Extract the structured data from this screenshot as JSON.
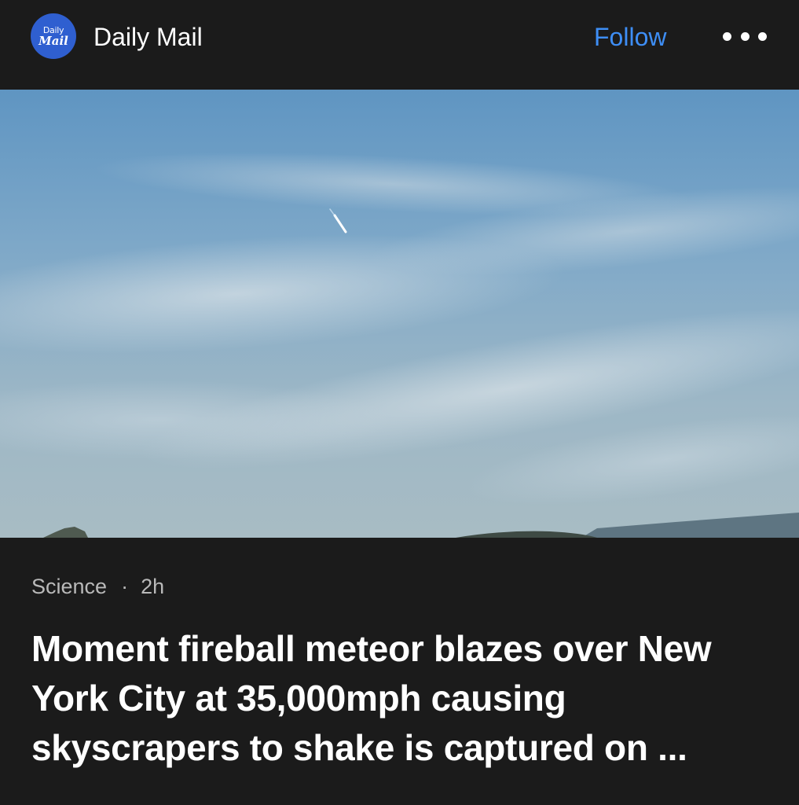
{
  "header": {
    "logo_line1": "Daily",
    "logo_line2": "Mail",
    "source_name": "Daily Mail",
    "follow_label": "Follow",
    "more_icon": "more-horizontal-icon"
  },
  "article": {
    "category": "Science",
    "separator": "·",
    "time_ago": "2h",
    "headline": "Moment fireball meteor blazes over New York City at 35,000mph causing skyscrapers to shake is captured on ..."
  },
  "colors": {
    "background": "#1b1b1b",
    "accent_follow": "#3e8ef5",
    "logo_blue": "#2f5fd0",
    "meta_text": "#b9b9b9"
  }
}
